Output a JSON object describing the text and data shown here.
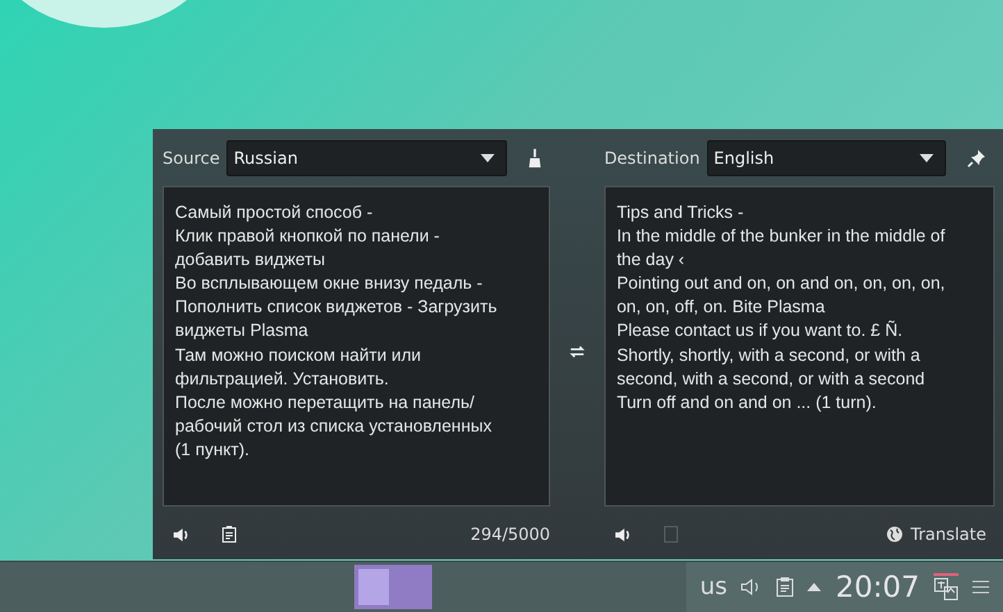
{
  "translator": {
    "source_label": "Source",
    "source_language": "Russian",
    "destination_label": "Destination",
    "destination_language": "English",
    "source_lines": [
      "Самый простой способ -",
      "Клик правой кнопкой по панели -",
      "добавить виджеты",
      "Во всплывающем окне внизу педаль -",
      "Пополнить список виджетов - Загрузить",
      "виджеты Plasma",
      "Там можно поиском найти или",
      "фильтрацией. Установить.",
      "После можно перетащить на панель/",
      "рабочий стол из списка установленных",
      "(1 пункт)."
    ],
    "translation_lines": [
      "Tips and Tricks -",
      "In the middle of the bunker in the middle of",
      "the day ‹",
      "Pointing out and on, on and on, on, on, on,",
      "on, on, off, on. Bite Plasma",
      "Please contact us if you want to. £ Ñ.",
      "Shortly, shortly, with a second, or with a",
      "second, with a second, or with a second",
      "Turn off and on and on ... (1 turn)."
    ],
    "char_count": "294/5000",
    "copy_disabled": true,
    "translate_button": "Translate"
  },
  "taskbar": {
    "pager": [
      {
        "selected": true
      },
      {
        "selected": false
      }
    ],
    "keyboard_layout": "us",
    "clock": "20:07"
  }
}
